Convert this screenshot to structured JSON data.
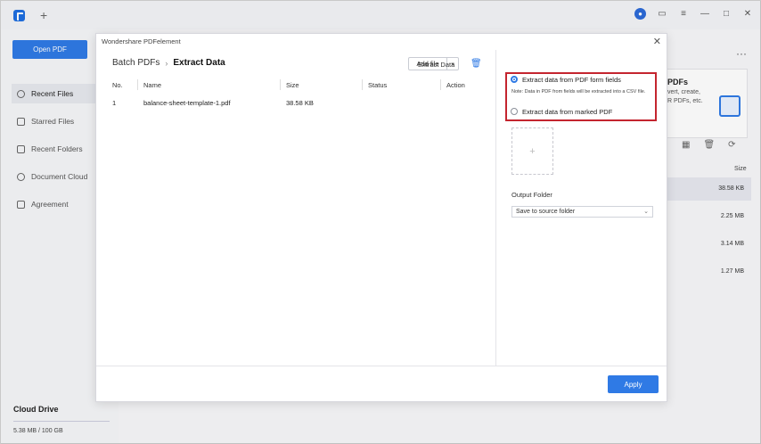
{
  "sidebar": {
    "open_pdf_label": "Open PDF",
    "items": [
      {
        "label": "Recent Files"
      },
      {
        "label": "Starred Files"
      },
      {
        "label": "Recent Folders"
      },
      {
        "label": "Document Cloud"
      },
      {
        "label": "Agreement"
      }
    ],
    "cloud_title": "Cloud Drive",
    "cloud_usage": "5.38 MB / 100 GB"
  },
  "titlebar": {
    "new_tab_glyph": "+",
    "icons": [
      "avatar-icon",
      "message-icon",
      "menu-icon",
      "minimize-icon",
      "maximize-icon",
      "close-icon"
    ]
  },
  "background": {
    "panel_title": "PDFs",
    "panel_lines": [
      "vert, create,",
      "R PDFs, etc."
    ],
    "size_header": "Size",
    "sizes": [
      "38.58 KB",
      "2.25 MB",
      "3.14 MB",
      "1.27 MB"
    ]
  },
  "dialog": {
    "title": "Wondershare PDFelement",
    "breadcrumb_parent": "Batch PDFs",
    "breadcrumb_current": "Extract Data",
    "add_file_label": "Add file",
    "table": {
      "headers": [
        "No.",
        "Name",
        "Size",
        "Status",
        "Action"
      ],
      "rows": [
        {
          "no": "1",
          "name": "balance-sheet-template-1.pdf",
          "size": "38.58 KB",
          "status": "",
          "action": ""
        }
      ]
    },
    "extract_title": "Extract Data",
    "option_fields": "Extract data from PDF form fields",
    "option_note": "Note: Data in PDF from fields will be extracted into a CSV file.",
    "option_marked": "Extract data from marked PDF",
    "output_folder_title": "Output Folder",
    "output_folder_value": "Save to source folder",
    "apply_label": "Apply"
  },
  "colors": {
    "accent": "#2f7ae5",
    "highlight": "#c4252f"
  }
}
